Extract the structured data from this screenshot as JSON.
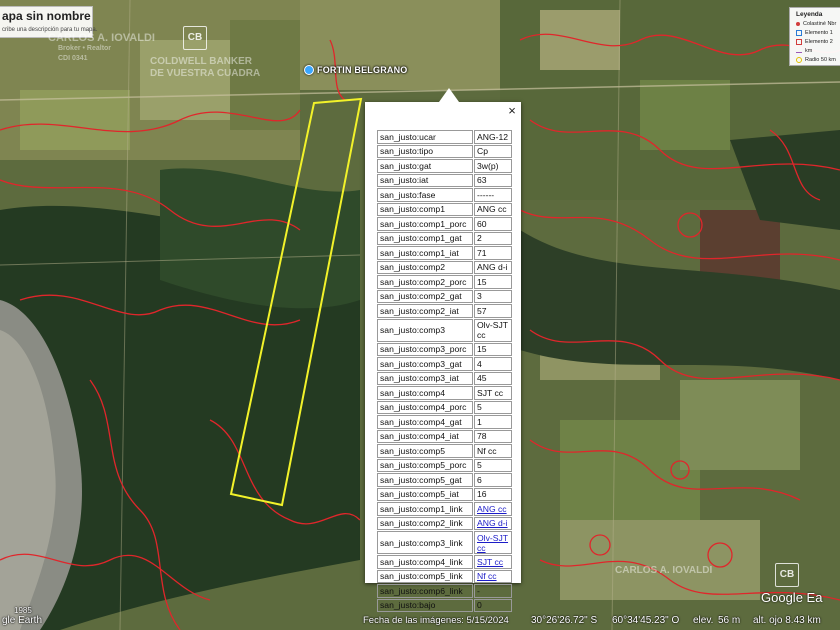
{
  "title": {
    "name": "apa sin nombre",
    "subtitle": "cribe una descripción para tu mapa."
  },
  "legend": {
    "title": "Leyenda",
    "items": [
      {
        "label": "Colastiné Nbr",
        "icon": "pin-icon",
        "color": "#d23c3c"
      },
      {
        "label": "Elemento 1",
        "icon": "shape-icon",
        "color": "#2a7bd6"
      },
      {
        "label": "Elemento 2",
        "icon": "shape-icon",
        "color": "#d23c3c"
      },
      {
        "label": "km",
        "icon": "line-icon",
        "color": "#9b59b6"
      },
      {
        "label": "Radio 50 km",
        "icon": "circle-icon",
        "color": "#e0c000"
      }
    ]
  },
  "place_label": "FORTIN BELGRANO",
  "watermarks": {
    "top_left_company": "CARLOS A. IOVALDI",
    "top_left_sub": "Broker • Realtor",
    "top_left_sub2": "CDI 0341",
    "coldwell": "COLDWELL BANKER",
    "coldwell2": "DE VUESTRA CUADRA",
    "bottom_right": "CARLOS A. IOVALDI",
    "badge": "CB"
  },
  "popup": {
    "close_symbol": "×",
    "rows": [
      {
        "key": "san_justo:ucar",
        "value": "ANG-12"
      },
      {
        "key": "san_justo:tipo",
        "value": "Cp"
      },
      {
        "key": "san_justo:gat",
        "value": "3w(p)"
      },
      {
        "key": "san_justo:iat",
        "value": "63"
      },
      {
        "key": "san_justo:fase",
        "value": "------"
      },
      {
        "key": "san_justo:comp1",
        "value": "ANG cc"
      },
      {
        "key": "san_justo:comp1_porc",
        "value": "60"
      },
      {
        "key": "san_justo:comp1_gat",
        "value": "2"
      },
      {
        "key": "san_justo:comp1_iat",
        "value": "71"
      },
      {
        "key": "san_justo:comp2",
        "value": "ANG d-i"
      },
      {
        "key": "san_justo:comp2_porc",
        "value": "15"
      },
      {
        "key": "san_justo:comp2_gat",
        "value": "3"
      },
      {
        "key": "san_justo:comp2_iat",
        "value": "57"
      },
      {
        "key": "san_justo:comp3",
        "value": "Olv-SJT cc"
      },
      {
        "key": "san_justo:comp3_porc",
        "value": "15"
      },
      {
        "key": "san_justo:comp3_gat",
        "value": "4"
      },
      {
        "key": "san_justo:comp3_iat",
        "value": "45"
      },
      {
        "key": "san_justo:comp4",
        "value": "SJT cc"
      },
      {
        "key": "san_justo:comp4_porc",
        "value": "5"
      },
      {
        "key": "san_justo:comp4_gat",
        "value": "1"
      },
      {
        "key": "san_justo:comp4_iat",
        "value": "78"
      },
      {
        "key": "san_justo:comp5",
        "value": "Nf cc"
      },
      {
        "key": "san_justo:comp5_porc",
        "value": "5"
      },
      {
        "key": "san_justo:comp5_gat",
        "value": "6"
      },
      {
        "key": "san_justo:comp5_iat",
        "value": "16"
      },
      {
        "key": "san_justo:comp1_link",
        "value": "ANG cc",
        "link": true
      },
      {
        "key": "san_justo:comp2_link",
        "value": "ANG d-i",
        "link": true
      },
      {
        "key": "san_justo:comp3_link",
        "value": "Olv-SJT cc",
        "link": true
      },
      {
        "key": "san_justo:comp4_link",
        "value": "SJT cc",
        "link": true
      },
      {
        "key": "san_justo:comp5_link",
        "value": "Nf cc",
        "link": true
      },
      {
        "key": "san_justo:comp6_link",
        "value": "-"
      },
      {
        "key": "san_justo:bajo",
        "value": "0"
      }
    ]
  },
  "statusbar": {
    "left_logo": "gle Earth",
    "year": "1985",
    "imagery_date": "Fecha de las imágenes: 5/15/2024",
    "lat": "30°26'26.72\" S",
    "lon": "60°34'45.23\" O",
    "elev_label": "elev.",
    "elev_value": "56 m",
    "eye_alt": "alt. ojo  8.43 km"
  },
  "brand": {
    "google_earth": "Google Ea"
  },
  "colors": {
    "soil_lines": "#e0262b",
    "parcel_outline": "#f2f22a",
    "link": "#1c1cc8"
  }
}
